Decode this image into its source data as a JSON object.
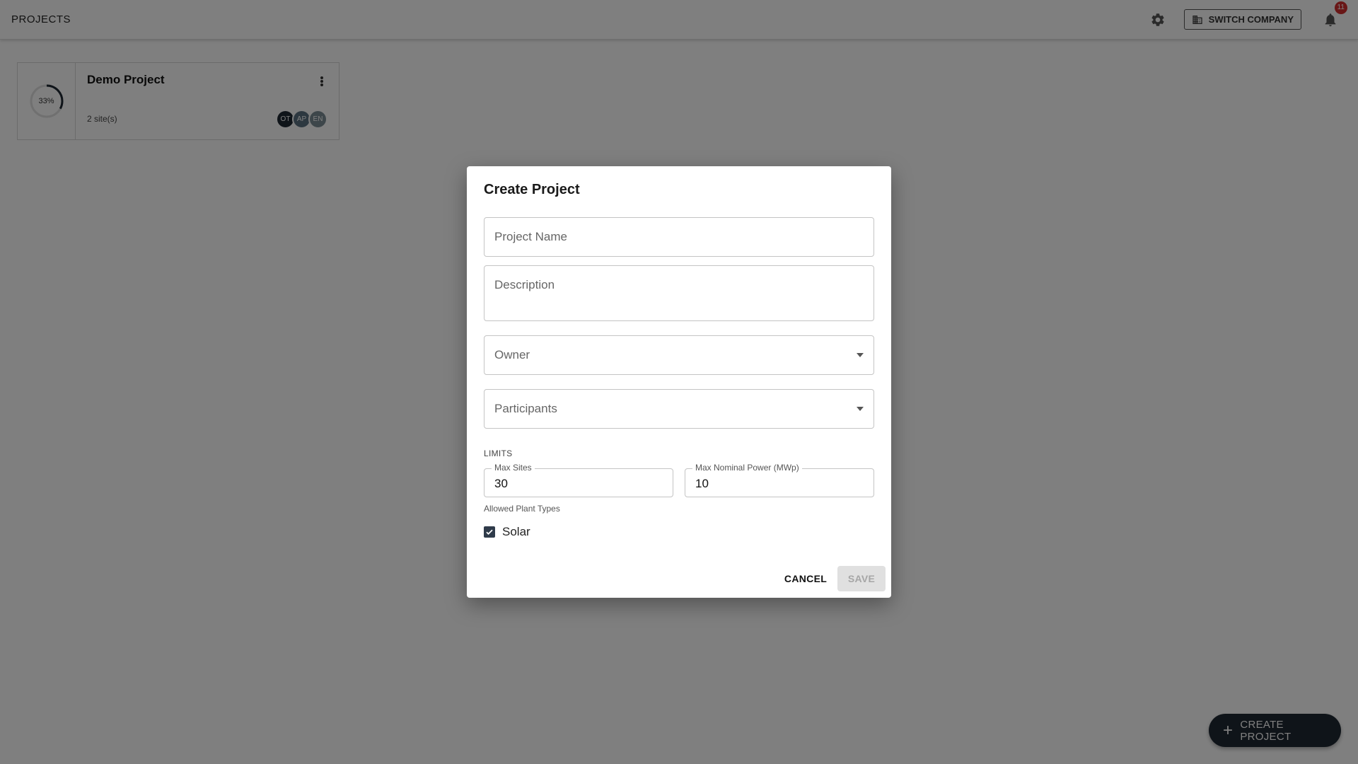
{
  "appbar": {
    "title": "PROJECTS",
    "switch_company_label": "SWITCH COMPANY",
    "notification_count": "11"
  },
  "projects": [
    {
      "name": "Demo Project",
      "progress_label": "33%",
      "progress_fraction": 0.33,
      "sites": "2 site(s)",
      "avatars": [
        {
          "initials": "OT",
          "color": "#1f2833"
        },
        {
          "initials": "AP",
          "color": "#5b7080"
        },
        {
          "initials": "EN",
          "color": "#7a8c94"
        }
      ]
    }
  ],
  "fab": {
    "label": "CREATE PROJECT"
  },
  "dialog": {
    "title": "Create Project",
    "project_name_placeholder": "Project Name",
    "description_placeholder": "Description",
    "owner_placeholder": "Owner",
    "participants_placeholder": "Participants",
    "limits_heading": "LIMITS",
    "max_sites_label": "Max Sites",
    "max_sites_value": "30",
    "max_power_label": "Max Nominal Power (MWp)",
    "max_power_value": "10",
    "allowed_plant_types_label": "Allowed Plant Types",
    "plant_types": [
      {
        "label": "Solar",
        "checked": true
      }
    ],
    "cancel_label": "CANCEL",
    "save_label": "SAVE"
  }
}
